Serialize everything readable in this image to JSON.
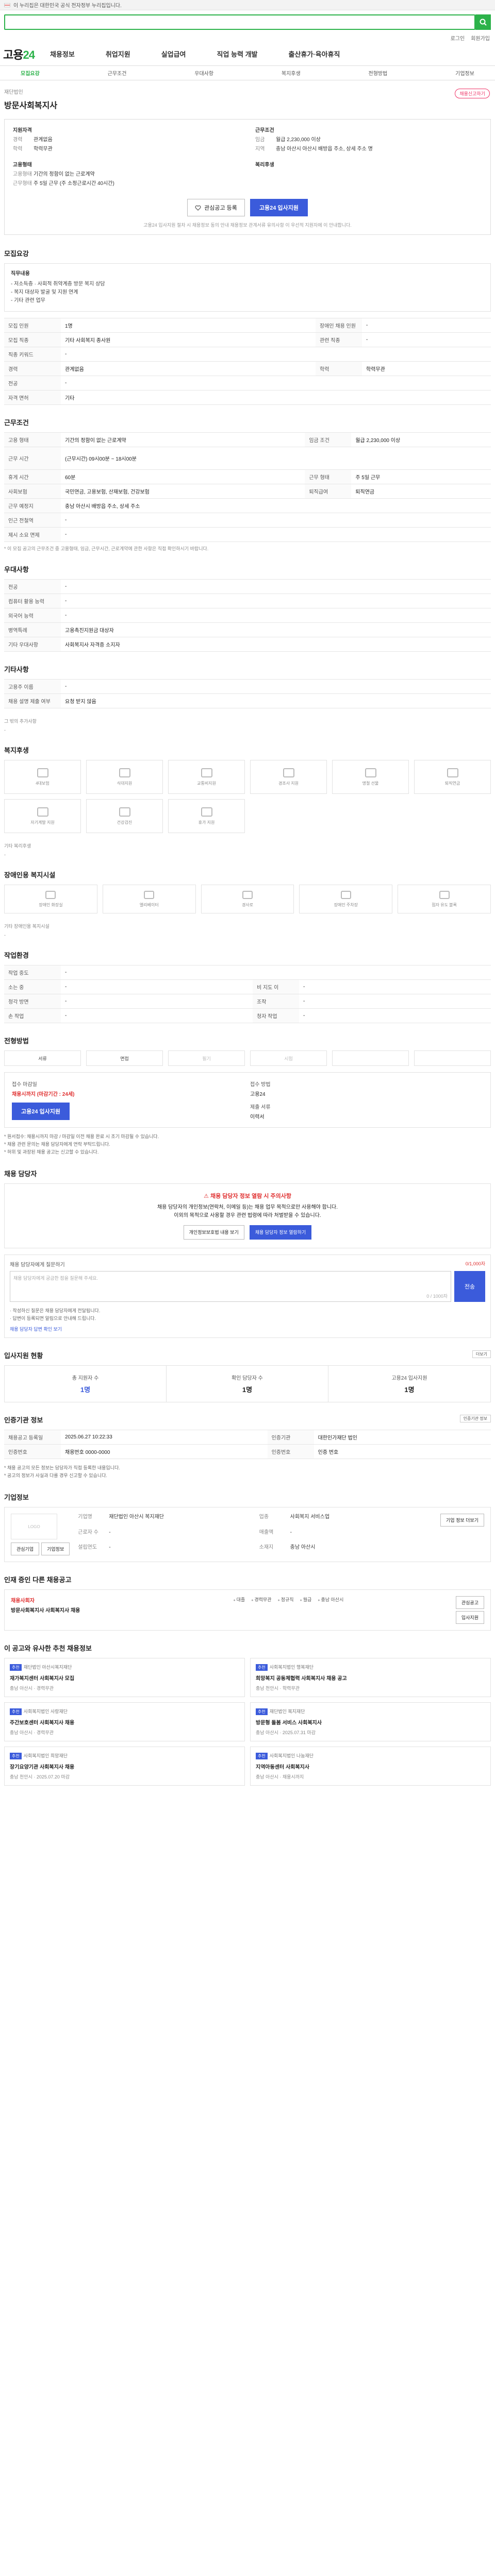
{
  "gov_notice": "이 누리집은 대한민국 공식 전자정부 누리집입니다.",
  "search": {
    "placeholder": ""
  },
  "util": [
    "로그인",
    "회원가입"
  ],
  "logo": {
    "main": "고용",
    "accent": "24"
  },
  "gnb": [
    "채용정보",
    "취업지원",
    "실업급여",
    "직업 능력 개발",
    "출산휴가·육아휴직"
  ],
  "subnav": [
    "모집요강",
    "근무조건",
    "우대사항",
    "복지후생",
    "전형방법",
    "기업정보"
  ],
  "title": {
    "breadcrumb": "재단법인",
    "name": "방문사회복지사",
    "report": "채용신고하기"
  },
  "summary": {
    "left_hd": "지원자격",
    "exp": {
      "k": "경력",
      "v": "관계없음"
    },
    "edu": {
      "k": "학력",
      "v": "학력무관"
    },
    "right_hd": "근무조건",
    "pay": {
      "k": "임금",
      "v": "월급 2,230,000 이상"
    },
    "loc": {
      "k": "지역",
      "v": "충남 아산시 아산시 배방읍 주소, 상세 주소 명"
    },
    "type_hd": "고용형태",
    "type": {
      "k": "고용형태",
      "v": "기간의 정함이 없는 근로계약"
    },
    "time_hd": "복리후생",
    "time": {
      "k": "근무형태",
      "v": "주 5일 근무 (주 소정근로시간 40시간)"
    }
  },
  "cta": {
    "scrap": "관심공고 등록",
    "apply": "고용24 입사지원"
  },
  "cta_note": "고용24 입사지원 절차 시 채용정보 동의 안내 채용정보 관계서류 유의사항 이 우선적 지원자에 이 안내합니다.",
  "s_recruit": {
    "h": "모집요강",
    "box_hd": "직무내용",
    "box_lines": [
      "- 저소득층 · 사회적 취약계층 방문 복지 상담",
      "- 복지 대상자 발굴 및 지원 연계",
      "- 기타 관련 업무"
    ],
    "rows": [
      {
        "k1": "모집 인원",
        "v1": "1명",
        "k2": "장애인 채용 인원",
        "v2": "-"
      },
      {
        "k1": "모집 직종",
        "v1": "기타 사회복지 종사원",
        "k2": "관련 직종",
        "v2": "-"
      },
      {
        "k1": "직종 키워드",
        "v1": "-",
        "k2": "",
        "v2": ""
      },
      {
        "k1": "경력",
        "v1": "관계없음",
        "k2": "학력",
        "v2": "학력무관"
      },
      {
        "k1": "전공",
        "v1": "-",
        "k2": "",
        "v2": ""
      },
      {
        "k1": "자격 면허",
        "v1": "기타",
        "k2": "",
        "v2": ""
      }
    ]
  },
  "s_cond": {
    "h": "근무조건",
    "rows": [
      {
        "k1": "고용 형태",
        "v1": "기간의 정함이 없는 근로계약",
        "k2": "임금 조건",
        "v2": "월급 2,230,000 이상"
      },
      {
        "k1": "근무 시간",
        "v1": "(근무시간) 09시00분 ~ 18시00분",
        "k2": "",
        "v2": ""
      },
      {
        "k1": "휴게 시간",
        "v1": "60분",
        "k2": "근무 형태",
        "v2": "주 5일 근무"
      },
      {
        "k1": "사회보험",
        "v1": "국민연금, 고용보험, 산재보험, 건강보험",
        "k2": "퇴직급여",
        "v2": "퇴직연금"
      },
      {
        "k1": "근무 예정지",
        "v1": "충남 아산시 배방읍 주소, 상세 주소",
        "k2": "",
        "v2": ""
      },
      {
        "k1": "인근 전철역",
        "v1": "-",
        "k2": "",
        "v2": ""
      },
      {
        "k1": "제시 소요 면제",
        "v1": "-",
        "k2": "",
        "v2": ""
      }
    ],
    "note": "* 이 모집 공고의 근무조건 중 고용형태, 임금, 근무시간, 근로계약에 관한 사항은 직접 확인하시기 바랍니다."
  },
  "s_pref": {
    "h": "우대사항",
    "rows": [
      {
        "k": "전공",
        "v": "-"
      },
      {
        "k": "컴퓨터 활용 능력",
        "v": "-"
      },
      {
        "k": "외국어 능력",
        "v": "-"
      },
      {
        "k": "병역특례",
        "v": "고용촉진지원금 대상자"
      },
      {
        "k": "기타 우대사항",
        "v": "사회복지사 자격증 소지자"
      }
    ]
  },
  "s_etc": {
    "h": "기타사항",
    "rows": [
      {
        "k": "고용주 이름",
        "v": "-"
      },
      {
        "k": "채용 설명 제출 여부",
        "v": "요청 받지 않음"
      }
    ],
    "sub": "그 밖의 추가사항"
  },
  "s_welfare": {
    "h": "복지후생",
    "items": [
      "4대보험",
      "식대지원",
      "교통비지원",
      "경조사 지원",
      "명절 선물",
      "퇴직연금",
      "자기계발 지원",
      "건강검진",
      "휴가 지원"
    ],
    "sub": "기타 복리후생",
    "sub_v": "-"
  },
  "s_disab": {
    "h": "장애인용 복지시설",
    "items": [
      "장애인 화장실",
      "엘리베이터",
      "경사로",
      "장애인 주차장",
      "점자 유도 블록"
    ],
    "sub": "기타 장애인용 복지시설",
    "sub_v": "-"
  },
  "s_work": {
    "h": "작업환경",
    "rows": [
      {
        "k1": "작업 중도",
        "v1": "-",
        "k2": "",
        "v2": ""
      },
      {
        "k1": "소는 중",
        "v1": "-",
        "k2": "비 지도 이",
        "v2": "-"
      },
      {
        "k1": "청각 방면",
        "v1": "-",
        "k2": "조작",
        "v2": "-"
      },
      {
        "k1": "손 작업",
        "v1": "-",
        "k2": "청자 작업",
        "v2": "-"
      }
    ]
  },
  "s_process": {
    "h": "전형방법",
    "steps": [
      "서류",
      "면접",
      "필기",
      "시험",
      "",
      ""
    ],
    "apply_hd": "접수 마감일",
    "deadline": "채용시까지 (마감기간 : 24세)",
    "method_hd": "접수 방법",
    "method": "고용24",
    "docs_hd": "제출 서류",
    "docs": "이력서",
    "apply_btn": "고용24 입사지원",
    "bullets": [
      "* 원서접수: 채용시까지 마감 / 마감일 이전 채용 완료 시 조기 마감될 수 있습니다.",
      "* 채용 관련 문의는 채용 담당자에게 연락 부탁드립니다.",
      "* 허위 및 과장된 채용 공고는 신고할 수 있습니다."
    ]
  },
  "s_contact": {
    "h": "채용 담당자",
    "warn_title": "채용 담당자 정보 열람 시 주의사항",
    "warn_line": "채용 담당자의 개인정보(연락처, 이메일 등)는 채용 업무 목적으로만 사용해야 합니다.",
    "warn_line2": "이외의 목적으로 사용할 경우 관련 법령에 따라 처벌받을 수 있습니다.",
    "btn1": "개인정보보호법 내용 보기",
    "btn2": "채용 담당자 정보 열람하기"
  },
  "s_qa": {
    "label": "채용 담당자에게 질문하기",
    "counter": "0/1,000자",
    "placeholder": "채용 담당자에게 궁금한 점을 질문해 주세요.",
    "count": "0 / 1000자",
    "btn": "전송",
    "note1": "· 작성하신 질문은 채용 담당자에게 전달됩니다.",
    "note2": "· 답변이 등록되면 알림으로 안내해 드립니다.",
    "link": "채용 담당자 답변 확인 보기"
  },
  "s_stats": {
    "h": "입사지원 현황",
    "link": "더보기",
    "items": [
      {
        "label": "총 지원자 수",
        "num": "1명"
      },
      {
        "label": "확인 담당자 수",
        "num": "1명"
      },
      {
        "label": "고용24 입사지원",
        "num": "1명"
      }
    ]
  },
  "s_info": {
    "h": "인증기관 정보",
    "btn": "인증기관 정보",
    "rows": [
      {
        "k1": "채용공고 등록일",
        "v1": "2025.06.27 10:22:33",
        "k2": "인증기관",
        "v2": "대한인가재단 법인"
      },
      {
        "k1": "인증번호",
        "v1": "채용번호 0000-0000",
        "k2": "인증번호",
        "v2": "인증 번호"
      }
    ],
    "bullets": [
      "* 채용 공고의 모든 정보는 담당자가 직접 등록한 내용입니다.",
      "* 공고의 정보가 사실과 다를 경우 신고할 수 있습니다."
    ]
  },
  "s_company": {
    "h": "기업정보",
    "logo": "LOGO",
    "btn_a": "관심기업",
    "btn_b": "기업정보",
    "k1": "기업명",
    "v1": "재단법인 아산시 복지재단",
    "k2": "업종",
    "v2": "사회복지 서비스업",
    "k3": "근로자 수",
    "v3": "-",
    "k4": "매출액",
    "v4": "-",
    "k5": "설립연도",
    "v5": "-",
    "k6": "소재지",
    "v6": "충남 아산시",
    "more": "기업 정보 더보기"
  },
  "s_other": {
    "h": "인재 증인 다른 채용공고",
    "red": "채용사회자",
    "title": "방문사회복지사 사회복지사 채용",
    "kws": [
      "대졸",
      "경력무관",
      "정규직",
      "월급",
      "충남 아산시"
    ],
    "btn_a": "관심공고",
    "btn_b": "입사지원"
  },
  "s_rec": {
    "h": "이 공고와 유사한 추천 채용정보",
    "cards": [
      {
        "badge": "추천",
        "co": "재단법인 아산시복지재단",
        "title": "재가복지센터 사회복지사 모집",
        "meta": "충남 아산시 · 경력무관"
      },
      {
        "badge": "추천",
        "co": "사회복지법인 행복재단",
        "title": "희망복지 공동체협력 사회복지사 채용 공고",
        "meta": "충남 천안시 · 학력무관"
      },
      {
        "badge": "추천",
        "co": "사회복지법인 사랑재단",
        "title": "주간보호센터 사회복지사 채용",
        "meta": "충남 아산시 · 경력무관"
      },
      {
        "badge": "추천",
        "co": "재단법인 복지재단",
        "title": "방문형 돌봄 서비스 사회복지사",
        "meta": "충남 아산시 · 2025.07.31 마감"
      },
      {
        "badge": "추천",
        "co": "사회복지법인 희망재단",
        "title": "장기요양기관 사회복지사 채용",
        "meta": "충남 천안시 · 2025.07.20 마감"
      },
      {
        "badge": "추천",
        "co": "사회복지법인 나눔재단",
        "title": "지역아동센터 사회복지사",
        "meta": "충남 아산시 · 채용시까지"
      }
    ]
  }
}
